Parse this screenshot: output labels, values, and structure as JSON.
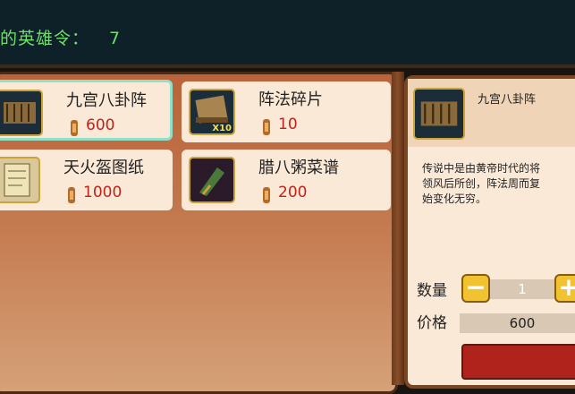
{
  "header": {
    "label": "的英雄令：",
    "count": "7"
  },
  "shop": {
    "items": [
      {
        "name": "九宫八卦阵",
        "price": "600",
        "icon": "formation-scroll-icon",
        "selected": true
      },
      {
        "name": "阵法碎片",
        "price": "10",
        "icon": "scroll-fragment-icon",
        "badge": "X10"
      },
      {
        "name": "天火盔图纸",
        "price": "1000",
        "icon": "blueprint-icon"
      },
      {
        "name": "腊八粥菜谱",
        "price": "200",
        "icon": "recipe-icon"
      }
    ]
  },
  "detail": {
    "name": "九宫八卦阵",
    "description": "传说中是由黄帝时代的将\n领风后所创，阵法周而复\n始变化无穷。",
    "quantity_label": "数量",
    "quantity": "1",
    "price_label": "价格",
    "price": "600"
  },
  "colors": {
    "header_text": "#6fe06a",
    "price_text": "#c0231a",
    "selected_border": "#8ee0c8"
  }
}
